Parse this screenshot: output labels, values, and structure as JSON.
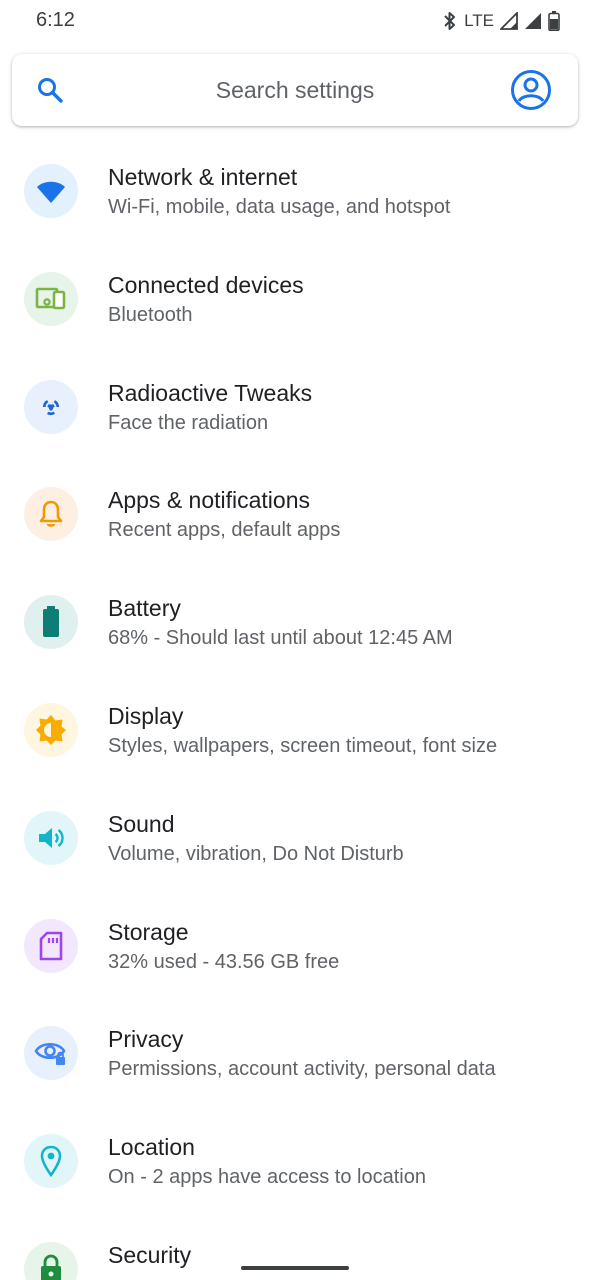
{
  "status_bar": {
    "time": "6:12",
    "network_label": "LTE",
    "icons": [
      "bluetooth-icon",
      "signal-icon",
      "signal-icon",
      "battery-icon"
    ]
  },
  "search": {
    "placeholder": "Search settings",
    "search_icon": "search-icon",
    "account_icon": "account-icon"
  },
  "items": [
    {
      "title": "Network & internet",
      "summary": "Wi-Fi, mobile, data usage, and hotspot",
      "icon": "wifi-icon",
      "icon_color": "#1a73e8",
      "icon_bg": "#e8f0fe"
    },
    {
      "title": "Connected devices",
      "summary": "Bluetooth",
      "icon": "devices-icon",
      "icon_color": "#4caf50",
      "icon_bg": "#e6f4ea"
    },
    {
      "title": "Radioactive Tweaks",
      "summary": "Face the radiation",
      "icon": "radiation-icon",
      "icon_color": "#1967d2",
      "icon_bg": "#e8f0fe"
    },
    {
      "title": "Apps & notifications",
      "summary": "Recent apps, default apps",
      "icon": "bell-icon",
      "icon_color": "#f29900",
      "icon_bg": "#fef0e1"
    },
    {
      "title": "Battery",
      "summary": "68% - Should last until about 12:45 AM",
      "icon": "battery-icon",
      "icon_color": "#0d7e76",
      "icon_bg": "#e0f0ee"
    },
    {
      "title": "Display",
      "summary": "Styles, wallpapers, screen timeout, font size",
      "icon": "brightness-icon",
      "icon_color": "#f9ab00",
      "icon_bg": "#fef7e0"
    },
    {
      "title": "Sound",
      "summary": "Volume, vibration, Do Not Disturb",
      "icon": "volume-icon",
      "icon_color": "#12b5cb",
      "icon_bg": "#e4f7fb"
    },
    {
      "title": "Storage",
      "summary": "32% used - 43.56 GB free",
      "icon": "sd-card-icon",
      "icon_color": "#a142f4",
      "icon_bg": "#f3e8fd"
    },
    {
      "title": "Privacy",
      "summary": "Permissions, account activity, personal data",
      "icon": "privacy-eye-icon",
      "icon_color": "#4285f4",
      "icon_bg": "#e8f0fe"
    },
    {
      "title": "Location",
      "summary": "On - 2 apps have access to location",
      "icon": "location-pin-icon",
      "icon_color": "#12b5cb",
      "icon_bg": "#e4f7fb"
    },
    {
      "title": "Security",
      "summary": "",
      "icon": "lock-icon",
      "icon_color": "#1e8e3e",
      "icon_bg": "#e6f4ea"
    }
  ]
}
